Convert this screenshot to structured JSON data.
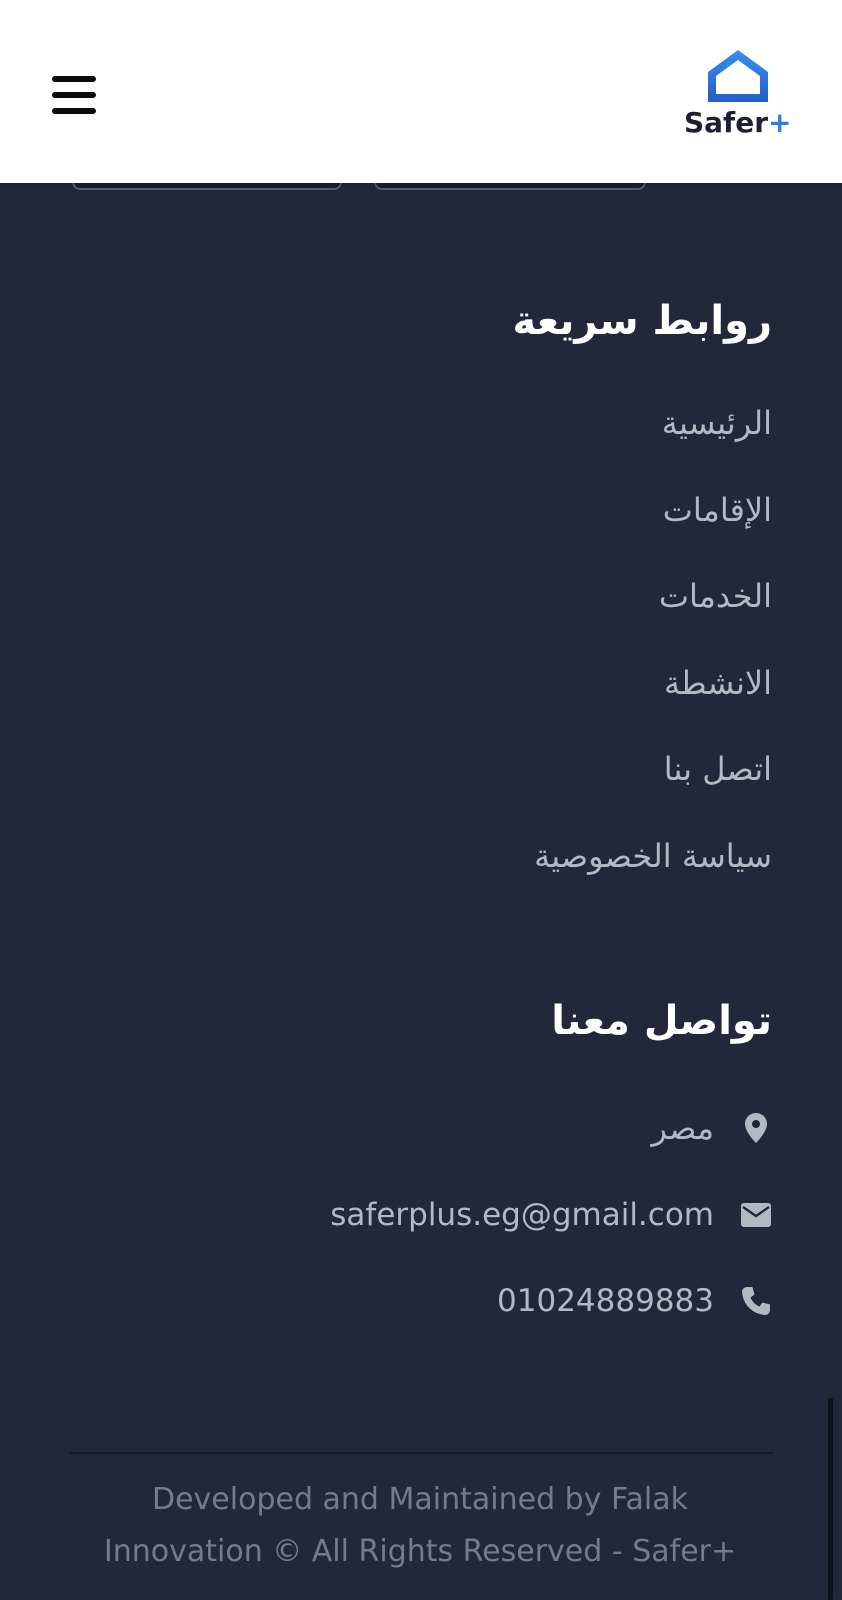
{
  "header": {
    "top_glyph": "",
    "logo": {
      "text": "Safer",
      "plus": "+",
      "brand_color": "#2f7de0"
    },
    "menu_icon": "hamburger-menu-icon"
  },
  "quick_links": {
    "title": "روابط سريعة",
    "items": [
      {
        "label": "الرئيسية"
      },
      {
        "label": "الإقامات"
      },
      {
        "label": "الخدمات"
      },
      {
        "label": "الانشطة"
      },
      {
        "label": "اتصل بنا"
      },
      {
        "label": "سياسة الخصوصية"
      }
    ]
  },
  "contact": {
    "title": "تواصل معنا",
    "location": {
      "icon": "map-pin-icon",
      "text": "مصر"
    },
    "email": {
      "icon": "envelope-icon",
      "text": "saferplus.eg@gmail.com"
    },
    "phone": {
      "icon": "phone-icon",
      "text": "01024889883"
    }
  },
  "footer": {
    "copyright": "Developed and Maintained by Falak Innovation © All Rights Reserved - Safer+"
  },
  "colors": {
    "background": "#222839",
    "header_bg": "#ffffff",
    "link_text": "#b4b8c3",
    "copyright_text": "#737b90"
  }
}
